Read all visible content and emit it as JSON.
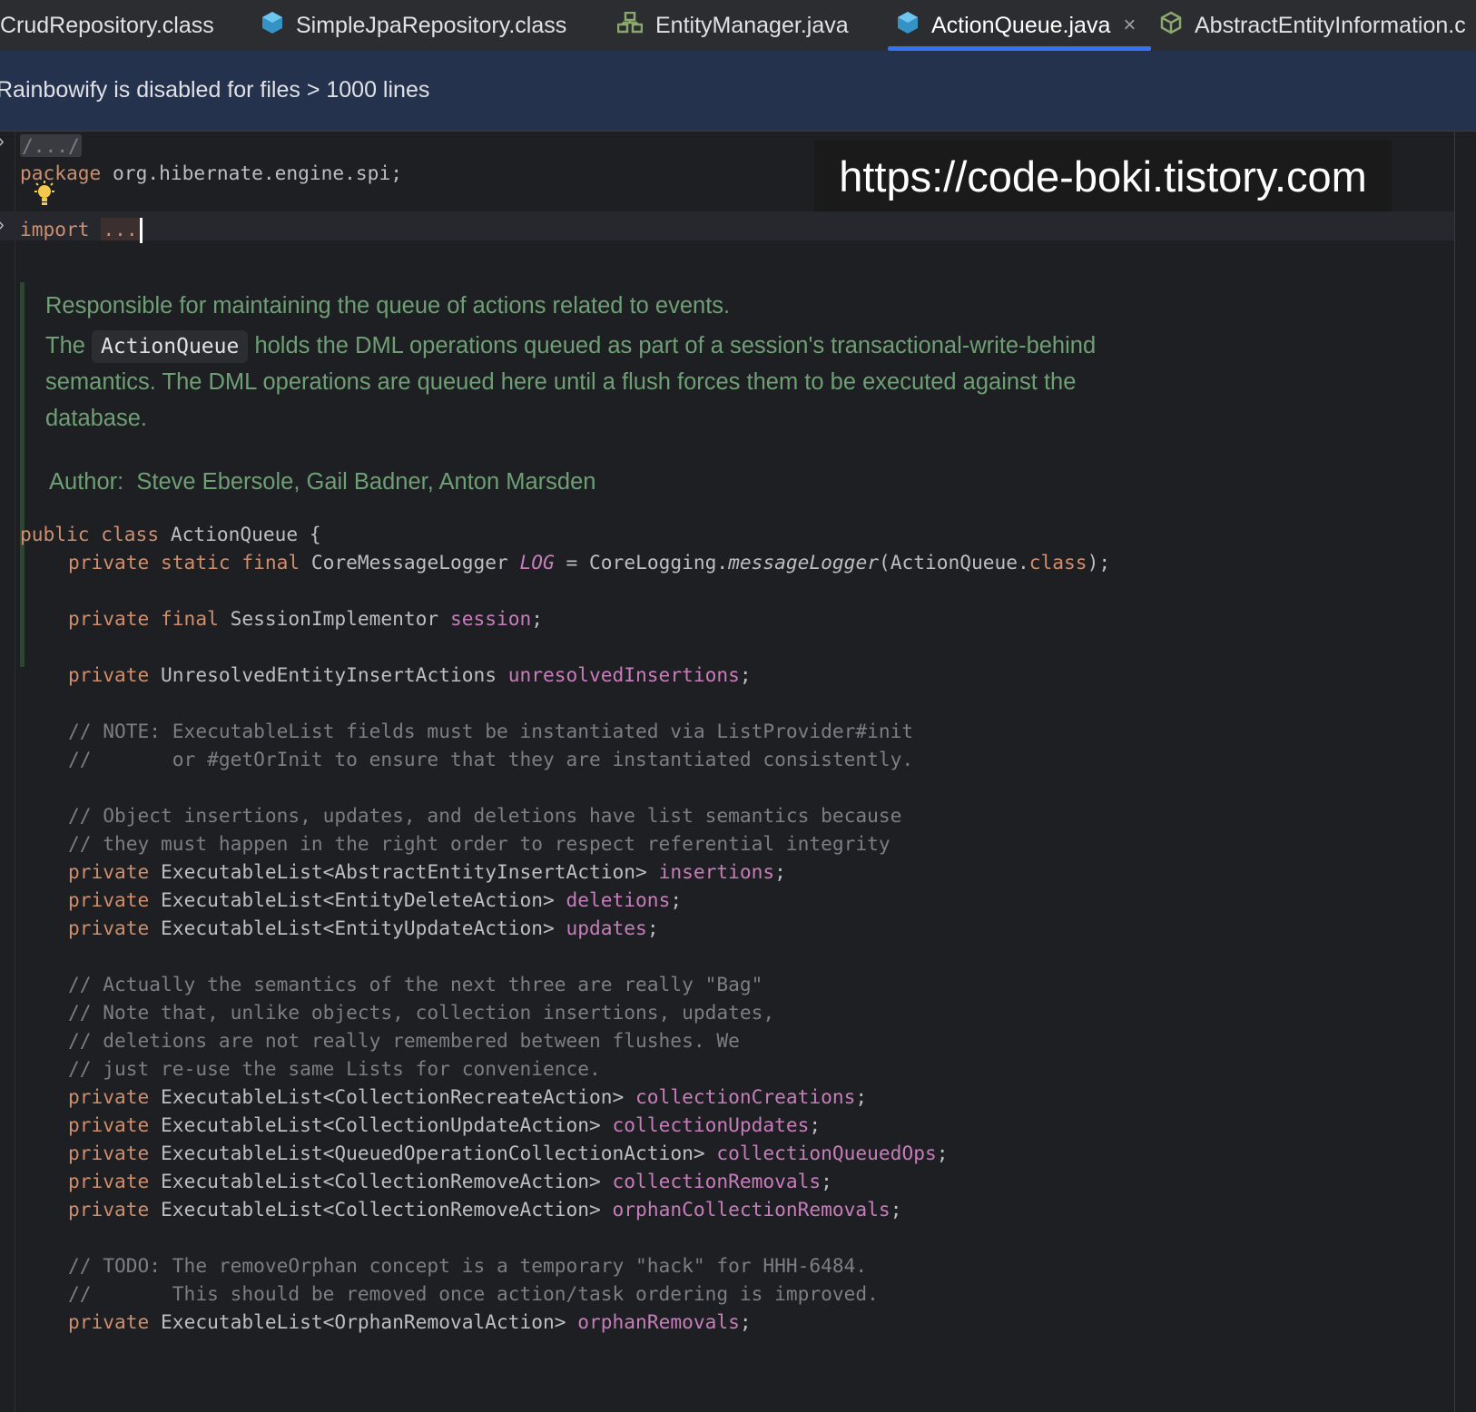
{
  "tabs": [
    {
      "label": "CrudRepository.class",
      "icon": "class-file-icon",
      "active": false
    },
    {
      "label": "SimpleJpaRepository.class",
      "icon": "class-file-icon",
      "active": false
    },
    {
      "label": "EntityManager.java",
      "icon": "interface-icon",
      "active": false
    },
    {
      "label": "ActionQueue.java",
      "icon": "class-file-icon",
      "active": true
    },
    {
      "label": "AbstractEntityInformation.c",
      "icon": "abstract-class-icon",
      "active": false
    }
  ],
  "tab_close_glyph": "×",
  "banner": {
    "text": "Rainbowify is disabled for files > 1000 lines"
  },
  "watermark": "https://code-boki.tistory.com",
  "code": {
    "header_fold": "/.../",
    "package_kw": "package",
    "package_name": " org.hibernate.engine.spi;",
    "import_kw": "import",
    "import_fold": "...",
    "javadoc": {
      "line1": "Responsible for maintaining the queue of actions related to events.",
      "line2_pre": "The ",
      "line2_code": "ActionQueue",
      "line2_post": " holds the DML operations queued as part of a session's transactional-write-behind",
      "line3": "semantics. The DML operations are queued here until a flush forces them to be executed against the",
      "line4": "database.",
      "author_label": "Author:",
      "author_names": "Steve Ebersole, Gail Badner, Anton Marsden"
    },
    "class_decl": {
      "kw": "public class",
      "name": " ActionQueue {"
    },
    "lines": {
      "log": {
        "kw": "private static final",
        "type": " CoreMessageLogger ",
        "name": "LOG",
        "mid": " = CoreLogging.",
        "method": "messageLogger",
        "args": "(ActionQueue.",
        "cls": "class",
        "end": ");"
      },
      "session": {
        "kw": "private final",
        "type": " SessionImplementor ",
        "name": "session",
        "end": ";"
      },
      "unresolved": {
        "kw": "private",
        "type": " UnresolvedEntityInsertActions ",
        "name": "unresolvedInsertions",
        "end": ";"
      },
      "c1": "// NOTE: ExecutableList fields must be instantiated via ListProvider#init",
      "c2": "//       or #getOrInit to ensure that they are instantiated consistently.",
      "c3": "// Object insertions, updates, and deletions have list semantics because",
      "c4": "// they must happen in the right order to respect referential integrity",
      "insertions": {
        "kw": "private",
        "type": " ExecutableList<AbstractEntityInsertAction> ",
        "name": "insertions",
        "end": ";"
      },
      "deletions": {
        "kw": "private",
        "type": " ExecutableList<EntityDeleteAction> ",
        "name": "deletions",
        "end": ";"
      },
      "updates": {
        "kw": "private",
        "type": " ExecutableList<EntityUpdateAction> ",
        "name": "updates",
        "end": ";"
      },
      "c5": "// Actually the semantics of the next three are really \"Bag\"",
      "c6": "// Note that, unlike objects, collection insertions, updates,",
      "c7": "// deletions are not really remembered between flushes. We",
      "c8": "// just re-use the same Lists for convenience.",
      "collectionCreations": {
        "kw": "private",
        "type": " ExecutableList<CollectionRecreateAction> ",
        "name": "collectionCreations",
        "end": ";"
      },
      "collectionUpdates": {
        "kw": "private",
        "type": " ExecutableList<CollectionUpdateAction> ",
        "name": "collectionUpdates",
        "end": ";"
      },
      "collectionQueuedOps": {
        "kw": "private",
        "type": " ExecutableList<QueuedOperationCollectionAction> ",
        "name": "collectionQueuedOps",
        "end": ";"
      },
      "collectionRemovals": {
        "kw": "private",
        "type": " ExecutableList<CollectionRemoveAction> ",
        "name": "collectionRemovals",
        "end": ";"
      },
      "orphanCollectionRemovals": {
        "kw": "private",
        "type": " ExecutableList<CollectionRemoveAction> ",
        "name": "orphanCollectionRemovals",
        "end": ";"
      },
      "c9": "// TODO: The removeOrphan concept is a temporary \"hack\" for HHH-6484.",
      "c10": "//       This should be removed once action/task ordering is improved.",
      "orphanRemovals": {
        "kw": "private",
        "type": " ExecutableList<OrphanRemovalAction> ",
        "name": "orphanRemovals",
        "end": ";"
      }
    }
  },
  "colors": {
    "keyword": "#cf8e6d",
    "field": "#c77dbb",
    "comment": "#7a7e85",
    "javadoc": "#6f9f75",
    "tab_underline": "#3574f0",
    "banner_bg": "#25324d"
  }
}
